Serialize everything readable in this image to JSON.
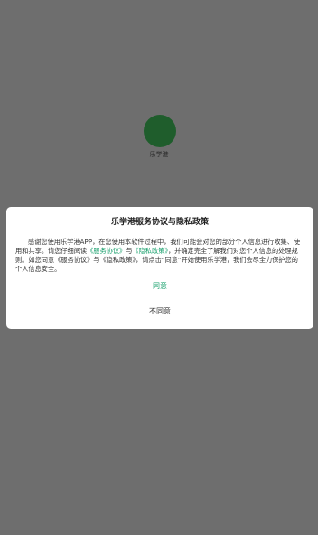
{
  "app": {
    "name": "乐学港"
  },
  "dialog": {
    "title": "乐学港服务协议与隐私政策",
    "body": {
      "part1": "感谢您使用乐学港APP，在您使用本软件过程中，我们可能会对您的部分个人信息进行收集、使用和共享。请您仔细阅读",
      "link_service_1": "《服务协议》",
      "and_1": "与",
      "link_privacy_1": "《隐私政策》",
      "part2": "，并确定完全了解我们对您个人信息的处理规则。如您同意",
      "link_service_2": "《服务协议》",
      "and_2": "与",
      "link_privacy_2": "《隐私政策》",
      "part3": "，请点击“同意”开始使用乐学港，我们会尽全力保护您的个人信息安全。"
    },
    "agree_label": "同意",
    "disagree_label": "不同意"
  },
  "colors": {
    "accent": "#1aa06d",
    "logo": "#1f5d2c",
    "overlay": "#6e6e6e"
  }
}
